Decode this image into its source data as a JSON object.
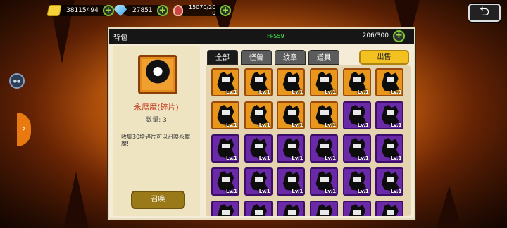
{
  "resources": {
    "gold": "38115494",
    "gems": "27851",
    "stamina_line1": "15070/20",
    "stamina_line2": "0",
    "plus": "+"
  },
  "back_icon": "⮌",
  "side_button_icon": "●●",
  "side_tab_arrow": "›",
  "panel": {
    "title": "背包",
    "fps": "FPS59",
    "capacity": "206/300",
    "capacity_plus": "+"
  },
  "item": {
    "name": "永腐魔(碎片)",
    "count": "数量: 3",
    "description": "收集30块碎片可以召唤永腐魔!",
    "summon_label": "召唤"
  },
  "tabs": [
    "全部",
    "怪兽",
    "纹章",
    "道具"
  ],
  "sell_label": "出售",
  "inventory": [
    {
      "frame": "orange",
      "level": "Lv.1"
    },
    {
      "frame": "orange",
      "level": "Lv.1"
    },
    {
      "frame": "orange",
      "level": "Lv.1"
    },
    {
      "frame": "orange",
      "level": "Lv.1"
    },
    {
      "frame": "orange",
      "level": "Lv.1"
    },
    {
      "frame": "orange",
      "level": "Lv.1"
    },
    {
      "frame": "orange",
      "level": "Lv.1"
    },
    {
      "frame": "orange",
      "level": "Lv.1"
    },
    {
      "frame": "orange",
      "level": "Lv.1"
    },
    {
      "frame": "orange",
      "level": "Lv.1"
    },
    {
      "frame": "purple",
      "level": "Lv.1"
    },
    {
      "frame": "purple",
      "level": "Lv.1"
    },
    {
      "frame": "purple",
      "level": "Lv.1"
    },
    {
      "frame": "purple",
      "level": "Lv.1"
    },
    {
      "frame": "purple",
      "level": "Lv.1"
    },
    {
      "frame": "purple",
      "level": "Lv.1"
    },
    {
      "frame": "purple",
      "level": "Lv.1"
    },
    {
      "frame": "purple",
      "level": "Lv.1"
    },
    {
      "frame": "purple",
      "level": "Lv.1"
    },
    {
      "frame": "purple",
      "level": "Lv.1"
    },
    {
      "frame": "purple",
      "level": "Lv.1"
    },
    {
      "frame": "purple",
      "level": "Lv.1"
    },
    {
      "frame": "purple",
      "level": "Lv.1"
    },
    {
      "frame": "purple",
      "level": "Lv.1"
    },
    {
      "frame": "purple",
      "level": ""
    },
    {
      "frame": "purple",
      "level": ""
    },
    {
      "frame": "purple",
      "level": ""
    },
    {
      "frame": "purple",
      "level": ""
    },
    {
      "frame": "purple",
      "level": ""
    },
    {
      "frame": "purple",
      "level": ""
    }
  ],
  "colors": {
    "orange_frame": "#e8961c",
    "purple_frame": "#6a2aa8",
    "item_name": "#c1361a",
    "fps": "#3fe04a"
  }
}
